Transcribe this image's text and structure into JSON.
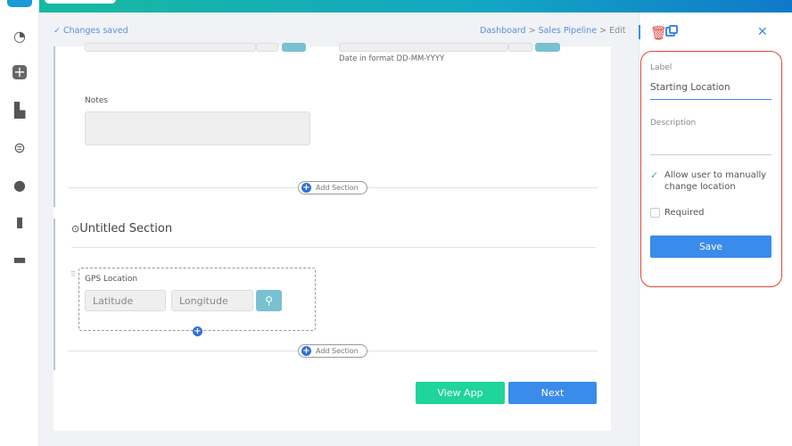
{
  "header": {
    "status": "Changes saved",
    "breadcrumb": [
      "Dashboard",
      "Sales Pipeline",
      "Edit"
    ],
    "separator": ">"
  },
  "sidebar": {
    "icons": [
      "speedometer-icon",
      "plus-square-icon",
      "shopping-bag-settings-icon",
      "group-icon",
      "globe-icon",
      "book-info-icon",
      "chat-icon"
    ]
  },
  "form": {
    "date_hint": "Date in format DD-MM-YYYY",
    "notes_label": "Notes",
    "add_section": "Add Section",
    "section_title": "Untitled Section",
    "gps": {
      "label": "GPS Location",
      "lat_placeholder": "Latitude",
      "lng_placeholder": "Longitude"
    },
    "view_app": "View App",
    "next": "Next"
  },
  "panel": {
    "label_title": "Label",
    "label_value": "Starting Location",
    "description_title": "Description",
    "description_value": "",
    "allow_manual": "Allow user to manually change location",
    "allow_manual_checked": true,
    "required": "Required",
    "required_checked": false,
    "save": "Save"
  },
  "colors": {
    "accent": "#3b8beb",
    "green": "#1fd59a",
    "red": "#e0463a",
    "teal": "#79c1d0"
  }
}
